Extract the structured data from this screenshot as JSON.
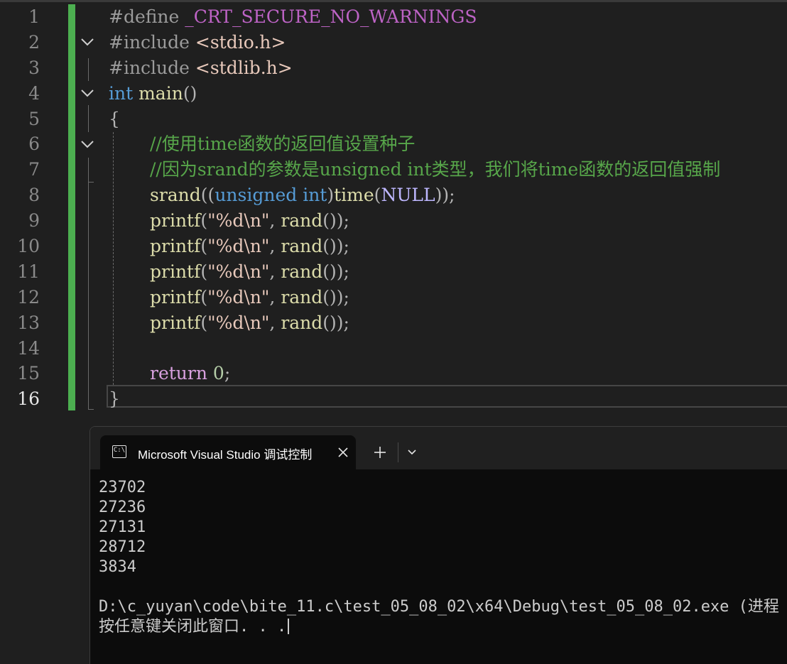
{
  "editor": {
    "line_numbers": [
      "1",
      "2",
      "3",
      "4",
      "5",
      "6",
      "7",
      "8",
      "9",
      "10",
      "11",
      "12",
      "13",
      "14",
      "15",
      "16"
    ],
    "active_line": "16",
    "code": {
      "l1_pre": "#define",
      "l1_macro": " _CRT_SECURE_NO_WARNINGS",
      "l2_pre": "#include",
      "l2_str": " <stdio.h>",
      "l3_pre": "#include",
      "l3_str": " <stdlib.h>",
      "l4_kw": "int",
      "l4_fn": " main",
      "l4_punc": "()",
      "l5_brace": "{",
      "l6_comment": "//使用time函数的返回值设置种子",
      "l7_comment": "//因为srand的参数是unsigned int类型，我们将time函数的返回值强制",
      "l8_fn": "srand",
      "l8_p1": "((",
      "l8_kw1": "unsigned",
      "l8_sp": " ",
      "l8_kw2": "int",
      "l8_p2": ")",
      "l8_fn2": "time",
      "l8_p3": "(",
      "l8_null": "NULL",
      "l8_p4": "));",
      "printf_fn": "printf",
      "printf_p1": "(",
      "printf_q1": "\"",
      "printf_fmt": "%d",
      "printf_esc": "\\n",
      "printf_q2": "\"",
      "printf_comma": ", ",
      "printf_rand": "rand",
      "printf_p2": "());",
      "l15_kw": "return",
      "l15_num": " 0",
      "l15_semi": ";",
      "l16_brace": "}"
    }
  },
  "console": {
    "icon_label": "C:\\",
    "tab_title": "Microsoft Visual Studio 调试控制台",
    "output": [
      "23702",
      "27236",
      "27131",
      "28712",
      "3834",
      ""
    ],
    "exit_line": "D:\\c_yuyan\\code\\bite_11.c\\test_05_08_02\\x64\\Debug\\test_05_08_02.exe (进程",
    "prompt": "按任意键关闭此窗口. . ."
  },
  "colors": {
    "editor_bg": "#1f1f1f",
    "change_bar": "#4caf50",
    "comment": "#57a64a",
    "keyword": "#569cd6",
    "function": "#dcdcaa",
    "console_bg": "#0c0c0c"
  }
}
